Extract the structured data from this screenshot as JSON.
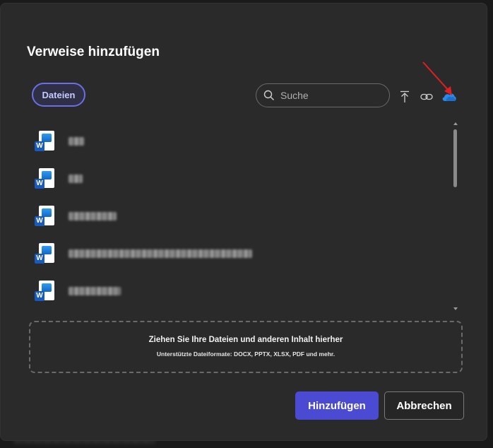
{
  "dialog": {
    "title": "Verweise hinzufügen",
    "tab_label": "Dateien",
    "search": {
      "placeholder": "Suche",
      "value": ""
    },
    "tools": [
      {
        "name": "upload-icon"
      },
      {
        "name": "link-icon"
      },
      {
        "name": "onedrive-cloud-icon"
      }
    ],
    "files": [
      {
        "icon": "word-file-icon",
        "badge": "W"
      },
      {
        "icon": "word-file-icon",
        "badge": "W"
      },
      {
        "icon": "word-file-icon",
        "badge": "W"
      },
      {
        "icon": "word-file-icon",
        "badge": "W"
      },
      {
        "icon": "word-file-icon",
        "badge": "W"
      }
    ],
    "dropzone": {
      "main": "Ziehen Sie Ihre Dateien und anderen Inhalt hierher",
      "sub": "Unterstützte Dateiformate: DOCX, PPTX, XLSX, PDF und mehr."
    },
    "buttons": {
      "add": "Hinzufügen",
      "cancel": "Abbrechen"
    }
  },
  "colors": {
    "accent": "#4b4ad3",
    "tab_border": "#6b6fe6",
    "annotation_arrow": "#e02020",
    "word_blue": "#185abd"
  }
}
